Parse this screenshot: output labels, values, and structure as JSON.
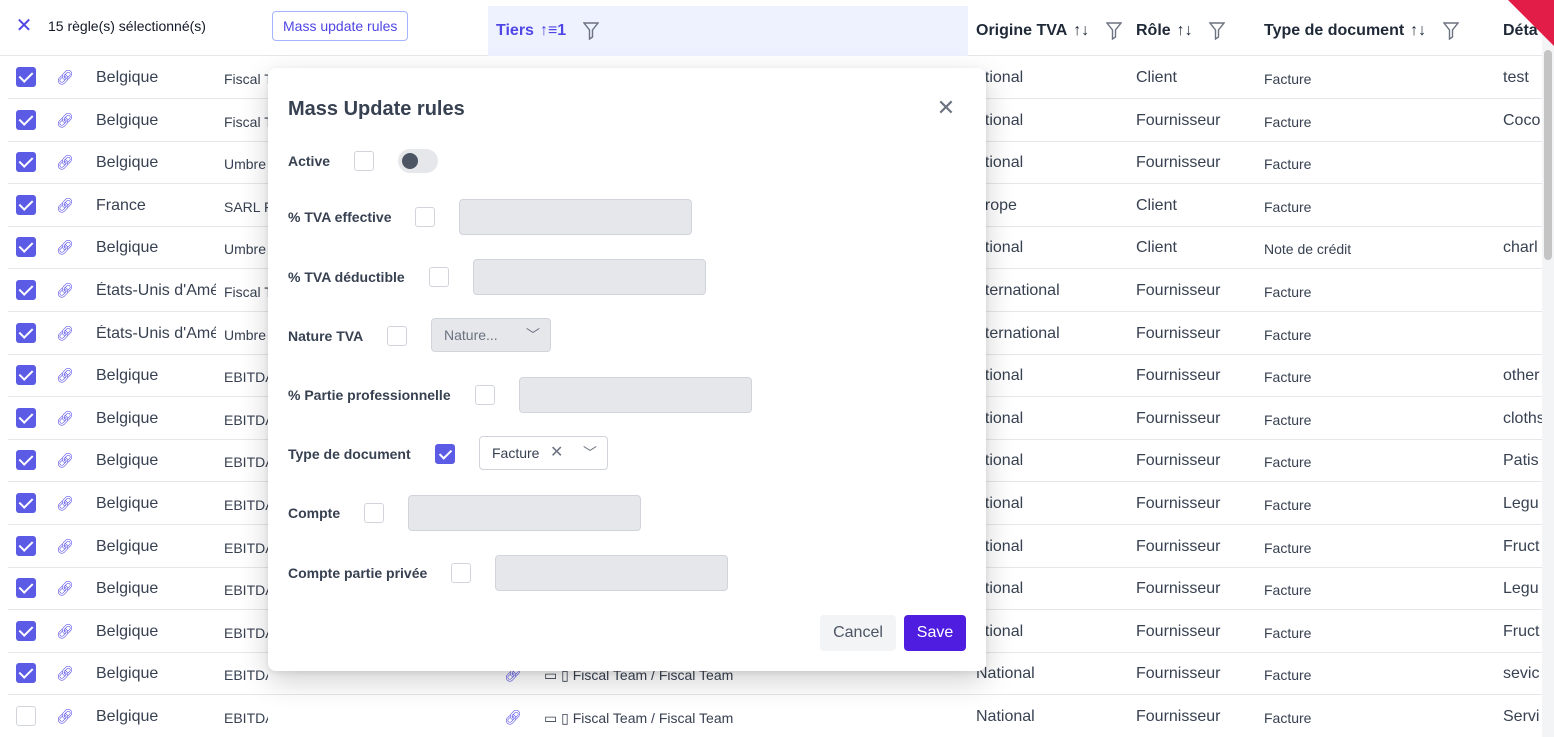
{
  "toolbar": {
    "selection_text": "15 règle(s) sélectionné(s)",
    "mass_update_label": "Mass update rules"
  },
  "columns": {
    "tiers": "Tiers",
    "tiers_sort": "1",
    "origine": "Origine TVA",
    "role": "Rôle",
    "type": "Type de document",
    "detail": "Déta"
  },
  "rows": [
    {
      "checked": true,
      "country": "Belgique",
      "entity": "Fiscal T",
      "origin": "ational",
      "role": "Client",
      "type": "Facture",
      "detail": "test"
    },
    {
      "checked": true,
      "country": "Belgique",
      "entity": "Fiscal T",
      "origin": "ational",
      "role": "Fournisseur",
      "type": "Facture",
      "detail": "Coco"
    },
    {
      "checked": true,
      "country": "Belgique",
      "entity": "Umbre",
      "origin": "ational",
      "role": "Fournisseur",
      "type": "Facture",
      "detail": ""
    },
    {
      "checked": true,
      "country": "France",
      "entity": "SARL F",
      "origin": "urope",
      "role": "Client",
      "type": "Facture",
      "detail": ""
    },
    {
      "checked": true,
      "country": "Belgique",
      "entity": "Umbre",
      "origin": "ational",
      "role": "Client",
      "type": "Note de crédit",
      "detail": "charl"
    },
    {
      "checked": true,
      "country": "États-Unis d'Amé",
      "entity": "Fiscal T",
      "origin": "nternational",
      "role": "Fournisseur",
      "type": "Facture",
      "detail": ""
    },
    {
      "checked": true,
      "country": "États-Unis d'Amé",
      "entity": "Umbre",
      "origin": "nternational",
      "role": "Fournisseur",
      "type": "Facture",
      "detail": ""
    },
    {
      "checked": true,
      "country": "Belgique",
      "entity": "EBITDA",
      "origin": "ational",
      "role": "Fournisseur",
      "type": "Facture",
      "detail": "other"
    },
    {
      "checked": true,
      "country": "Belgique",
      "entity": "EBITDA",
      "origin": "ational",
      "role": "Fournisseur",
      "type": "Facture",
      "detail": "cloths"
    },
    {
      "checked": true,
      "country": "Belgique",
      "entity": "EBITDA",
      "origin": "ational",
      "role": "Fournisseur",
      "type": "Facture",
      "detail": "Patis"
    },
    {
      "checked": true,
      "country": "Belgique",
      "entity": "EBITDA",
      "origin": "ational",
      "role": "Fournisseur",
      "type": "Facture",
      "detail": "Legu"
    },
    {
      "checked": true,
      "country": "Belgique",
      "entity": "EBITDA",
      "origin": "ational",
      "role": "Fournisseur",
      "type": "Facture",
      "detail": "Fruct"
    },
    {
      "checked": true,
      "country": "Belgique",
      "entity": "EBITDA",
      "origin": "ational",
      "role": "Fournisseur",
      "type": "Facture",
      "detail": "Legu"
    },
    {
      "checked": true,
      "country": "Belgique",
      "entity": "EBITDA",
      "origin": "ational",
      "role": "Fournisseur",
      "type": "Facture",
      "detail": "Fruct"
    },
    {
      "checked": true,
      "country": "Belgique",
      "entity": "EBITDA",
      "fiscal": "Fiscal Team / Fiscal Team",
      "origin": "National",
      "role": "Fournisseur",
      "type": "Facture",
      "detail": "sevic"
    },
    {
      "checked": false,
      "country": "Belgique",
      "entity": "EBITDA",
      "fiscal": "Fiscal Team / Fiscal Team",
      "origin": "National",
      "role": "Fournisseur",
      "type": "Facture",
      "detail": "Servi"
    }
  ],
  "modal": {
    "title": "Mass Update rules",
    "fields": {
      "active": "Active",
      "tva_effective": "% TVA effective",
      "tva_deductible": "% TVA déductible",
      "nature_tva": "Nature TVA",
      "nature_placeholder": "Nature...",
      "partie_pro": "% Partie professionnelle",
      "type_document": "Type de document",
      "type_value": "Facture",
      "compte": "Compte",
      "compte_privee": "Compte partie privée"
    },
    "cancel_label": "Cancel",
    "save_label": "Save"
  },
  "colors": {
    "accent": "#4f46e5",
    "save_bg": "#4f1de0",
    "badge": "#e11d48"
  }
}
